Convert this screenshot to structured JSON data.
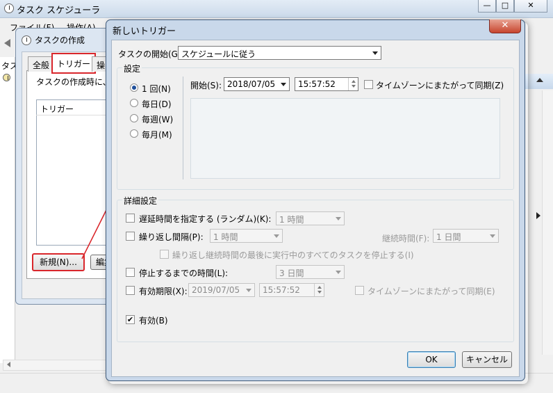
{
  "main": {
    "title": "タスク スケジューラ",
    "caption": {
      "minimize": "—",
      "maximize": "□",
      "close": "✕"
    },
    "menu": [
      "ファイル(F)",
      "操作(A)"
    ],
    "left_label": "タス"
  },
  "create_task": {
    "title": "タスクの作成",
    "tabs": [
      "全般",
      "トリガー",
      "操作"
    ],
    "description": "タスクの作成時に、タ",
    "column": "トリガー",
    "new_button": "新規(N)...",
    "edit_button": "編集"
  },
  "new_trigger": {
    "title": "新しいトリガー",
    "close": "✕",
    "begin_label": "タスクの開始(G):",
    "begin_value": "スケジュールに従う",
    "settings_label": "設定",
    "schedule": [
      {
        "label": "1 回(N)",
        "selected": true
      },
      {
        "label": "毎日(D)",
        "selected": false
      },
      {
        "label": "毎週(W)",
        "selected": false
      },
      {
        "label": "毎月(M)",
        "selected": false
      }
    ],
    "start_label": "開始(S):",
    "start_date": "2018/07/05",
    "start_time": "15:57:52",
    "sync_tz": "タイムゾーンにまたがって同期(Z)",
    "advanced_label": "詳細設定",
    "delay": {
      "label": "遅延時間を指定する (ランダム)(K):",
      "value": "1 時間"
    },
    "repeat": {
      "label": "繰り返し間隔(P):",
      "value": "1 時間",
      "duration_label": "継続時間(F):",
      "duration_value": "1 日間"
    },
    "stop_all": "繰り返し継続時間の最後に実行中のすべてのタスクを停止する(I)",
    "stop_after": {
      "label": "停止するまでの時間(L):",
      "value": "3 日間"
    },
    "expire": {
      "label": "有効期限(X):",
      "date": "2019/07/05",
      "time": "15:57:52",
      "sync_tz": "タイムゾーンにまたがって同期(E)"
    },
    "enabled": {
      "label": "有効(B)",
      "checked": true
    },
    "ok": "OK",
    "cancel": "キャンセル"
  },
  "accent": {
    "annotation_red": "#d9262b",
    "radio_blue": "#1f4f9a"
  }
}
